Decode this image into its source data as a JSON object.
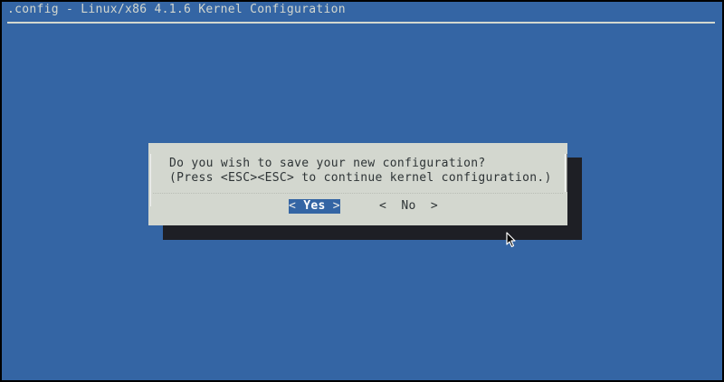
{
  "window": {
    "title": ".config - Linux/x86 4.1.6 Kernel Configuration"
  },
  "dialog": {
    "question": "Do you wish to save your new configuration?",
    "hint": "(Press <ESC><ESC> to continue kernel configuration.)",
    "buttons": {
      "yes_left": "<",
      "yes_label": " Yes ",
      "yes_right": ">",
      "no_label": "<  No  >"
    },
    "selected_button": "Yes"
  },
  "colors": {
    "background": "#3465a4",
    "dialog": "#d3d7cf",
    "shadow": "#1e1f25",
    "selected_button_bg": "#3465a4"
  },
  "icons": {
    "pointer": "mouse-pointer-icon"
  }
}
